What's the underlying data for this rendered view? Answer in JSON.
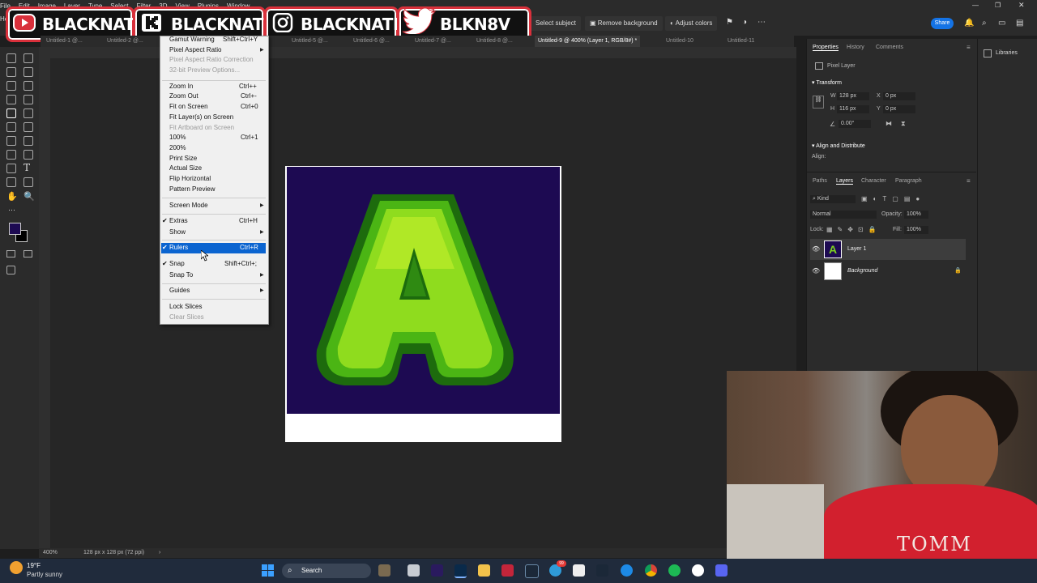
{
  "menubar": {
    "items": [
      "File",
      "Edit",
      "Image",
      "Layer",
      "Type",
      "Select",
      "Filter",
      "3D",
      "View",
      "Plugins",
      "Window",
      "Help"
    ]
  },
  "options_bar": {
    "select_subject": "Select subject",
    "remove_background": "Remove background",
    "adjust_colors": "Adjust colors",
    "share": "Share"
  },
  "banners": [
    {
      "label": "BLACKNATE",
      "icon": "youtube-icon"
    },
    {
      "label": "BLACKNATE",
      "icon": "kick-icon"
    },
    {
      "label": "BLACKNATEYT",
      "icon": "instagram-icon"
    },
    {
      "label": "BLKN8V",
      "icon": "twitter-icon"
    }
  ],
  "tabs": [
    {
      "label": "Untitled-1 @..."
    },
    {
      "label": "Untitled-2 @..."
    },
    {
      "label": "Untitled-5 @..."
    },
    {
      "label": "Untitled-6 @..."
    },
    {
      "label": "Untitled-7 @..."
    },
    {
      "label": "Untitled-8 @..."
    },
    {
      "label": "Untitled-9 @ 400% (Layer 1, RGB/8#) *"
    },
    {
      "label": "Untitled-10"
    },
    {
      "label": "Untitled-11"
    }
  ],
  "view_menu": {
    "items": [
      {
        "label": "Gamut Warning",
        "shortcut": "Shift+Ctrl+Y",
        "disabled": false
      },
      {
        "label": "Pixel Aspect Ratio",
        "shortcut": "",
        "submenu": true
      },
      {
        "label": "Pixel Aspect Ratio Correction",
        "shortcut": "",
        "disabled": true
      },
      {
        "label": "32-bit Preview Options...",
        "shortcut": "",
        "disabled": true
      },
      {
        "label": "Zoom In",
        "shortcut": "Ctrl++"
      },
      {
        "label": "Zoom Out",
        "shortcut": "Ctrl+-"
      },
      {
        "label": "Fit on Screen",
        "shortcut": "Ctrl+0"
      },
      {
        "label": "Fit Layer(s) on Screen",
        "shortcut": ""
      },
      {
        "label": "Fit Artboard on Screen",
        "shortcut": "",
        "disabled": true
      },
      {
        "label": "100%",
        "shortcut": "Ctrl+1"
      },
      {
        "label": "200%",
        "shortcut": ""
      },
      {
        "label": "Print Size",
        "shortcut": ""
      },
      {
        "label": "Actual Size",
        "shortcut": ""
      },
      {
        "label": "Flip Horizontal",
        "shortcut": ""
      },
      {
        "label": "Pattern Preview",
        "shortcut": ""
      },
      {
        "label": "Screen Mode",
        "shortcut": "",
        "submenu": true
      },
      {
        "label": "Extras",
        "shortcut": "Ctrl+H",
        "checked": true
      },
      {
        "label": "Show",
        "shortcut": "",
        "submenu": true
      },
      {
        "label": "Rulers",
        "shortcut": "Ctrl+R",
        "checked": true,
        "highlighted": true
      },
      {
        "label": "Snap",
        "shortcut": "Shift+Ctrl+;",
        "checked": true
      },
      {
        "label": "Snap To",
        "shortcut": "",
        "submenu": true
      },
      {
        "label": "Guides",
        "shortcut": "",
        "submenu": true
      },
      {
        "label": "Lock Slices",
        "shortcut": ""
      },
      {
        "label": "Clear Slices",
        "shortcut": "",
        "disabled": true
      }
    ]
  },
  "properties": {
    "tabs": [
      "Properties",
      "History",
      "Comments"
    ],
    "kind": "Pixel Layer",
    "transform_title": "Transform",
    "w_label": "W",
    "w": "128 px",
    "h_label": "H",
    "h": "116 px",
    "x_label": "X",
    "x": "0 px",
    "y_label": "Y",
    "y": "0 px",
    "angle": "0.00°",
    "align_title": "Align and Distribute",
    "align_label": "Align:"
  },
  "layers_panel": {
    "tabs": [
      "Paths",
      "Layers",
      "Character",
      "Paragraph"
    ],
    "filter": "Kind",
    "blend": "Normal",
    "opacity_label": "Opacity:",
    "opacity": "100%",
    "lock_label": "Lock:",
    "fill_label": "Fill:",
    "fill": "100%",
    "layers": [
      {
        "name": "Layer 1",
        "selected": true
      },
      {
        "name": "Background",
        "selected": false
      }
    ]
  },
  "libraries": "Libraries",
  "status": {
    "zoom": "400%",
    "doc_info": "128 px x 128 px (72 ppi)"
  },
  "taskbar": {
    "temp": "19°F",
    "condition": "Partly sunny",
    "search": "Search",
    "badge": "99"
  },
  "webcam_shirt_text": "TOMM",
  "colors": {
    "accent": "#0b64d0",
    "canvas_bg": "#1d0a52",
    "letter_green": "#7ed321",
    "banner_red": "#d9303b"
  }
}
